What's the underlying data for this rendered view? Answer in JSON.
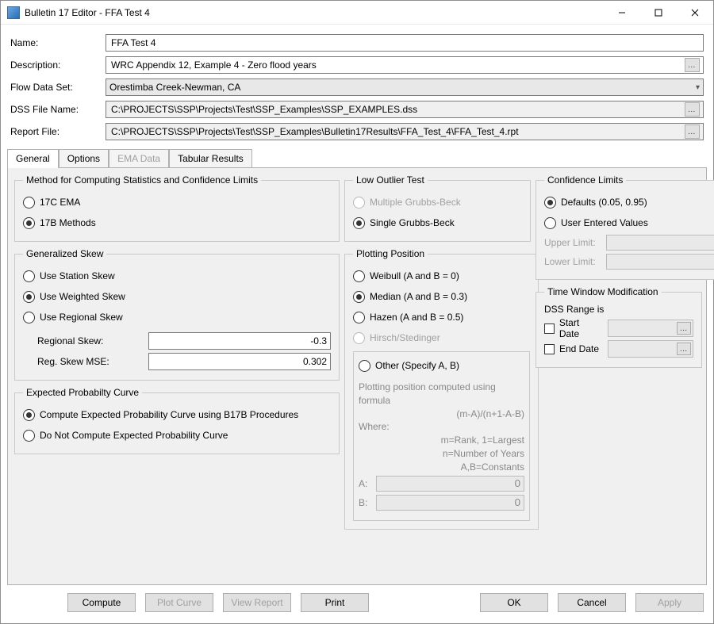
{
  "titlebar": {
    "title": "Bulletin 17 Editor - FFA Test 4"
  },
  "fields": {
    "name_label": "Name:",
    "name_value": "FFA Test 4",
    "desc_label": "Description:",
    "desc_value": "WRC Appendix 12, Example 4 - Zero flood years",
    "flowset_label": "Flow Data Set:",
    "flowset_value": "Orestimba Creek-Newman, CA",
    "dss_label": "DSS File Name:",
    "dss_value": "C:\\PROJECTS\\SSP\\Projects\\Test\\SSP_Examples\\SSP_EXAMPLES.dss",
    "report_label": "Report File:",
    "report_value": "C:\\PROJECTS\\SSP\\Projects\\Test\\SSP_Examples\\Bulletin17Results\\FFA_Test_4\\FFA_Test_4.rpt"
  },
  "tabs": {
    "general": "General",
    "options": "Options",
    "ema": "EMA Data",
    "tabular": "Tabular Results"
  },
  "method": {
    "legend": "Method for Computing Statistics and Confidence Limits",
    "opt_17c": "17C EMA",
    "opt_17b": "17B Methods"
  },
  "skew": {
    "legend": "Generalized Skew",
    "station": "Use Station Skew",
    "weighted": "Use Weighted Skew",
    "regional": "Use Regional Skew",
    "reg_skew_label": "Regional Skew:",
    "reg_skew_value": "-0.3",
    "reg_mse_label": "Reg. Skew MSE:",
    "reg_mse_value": "0.302"
  },
  "epc": {
    "legend": "Expected Probabilty Curve",
    "opt_compute": "Compute Expected Probability Curve using B17B Procedures",
    "opt_nocompute": "Do Not Compute Expected Probability Curve"
  },
  "outlier": {
    "legend": "Low Outlier Test",
    "multi": "Multiple Grubbs-Beck",
    "single": "Single Grubbs-Beck"
  },
  "pp": {
    "legend": "Plotting Position",
    "weibull": "Weibull (A and B = 0)",
    "median": "Median (A and B = 0.3)",
    "hazen": "Hazen (A and B = 0.5)",
    "hirsch": "Hirsch/Stedinger",
    "other": "Other (Specify A, B)",
    "formula_intro": "Plotting position computed using formula",
    "formula": "(m-A)/(n+1-A-B)",
    "where": "Where:",
    "where_m": "m=Rank, 1=Largest",
    "where_n": "n=Number of Years",
    "where_ab": "A,B=Constants",
    "a_label": "A:",
    "a_value": "0",
    "b_label": "B:",
    "b_value": "0"
  },
  "conf": {
    "legend": "Confidence Limits",
    "defaults": "Defaults (0.05, 0.95)",
    "user": "User Entered Values",
    "upper_label": "Upper Limit:",
    "lower_label": "Lower Limit:"
  },
  "tw": {
    "legend": "Time Window Modification",
    "dss_range": "DSS Range is",
    "start": "Start Date",
    "end": "End Date"
  },
  "buttons": {
    "compute": "Compute",
    "plot": "Plot Curve",
    "view": "View Report",
    "print": "Print",
    "ok": "OK",
    "cancel": "Cancel",
    "apply": "Apply"
  }
}
